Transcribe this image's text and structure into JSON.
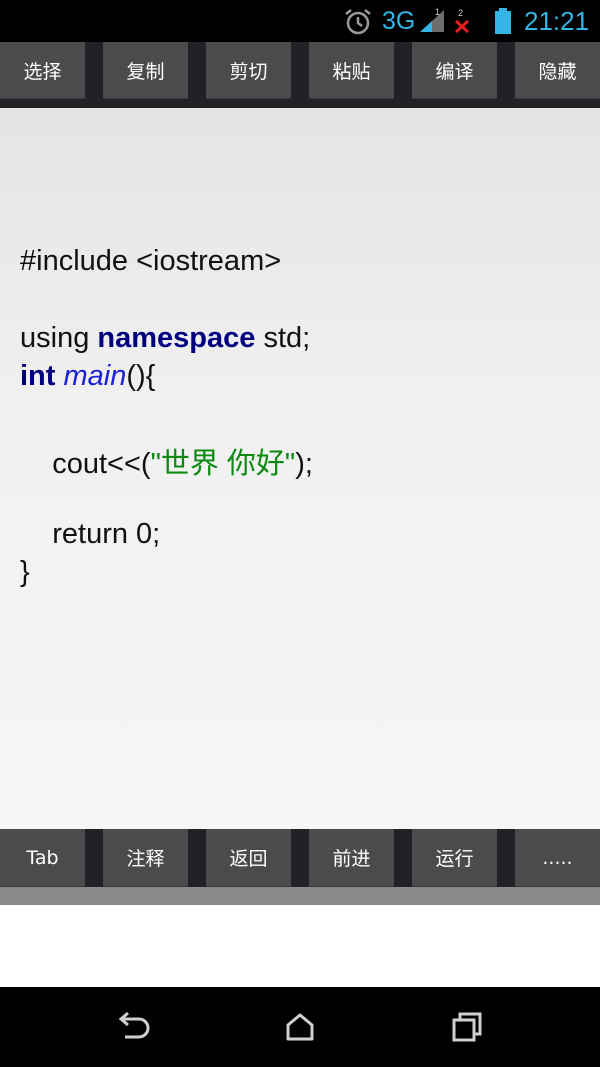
{
  "status_bar": {
    "network": "3G",
    "time": "21:21",
    "sim1_label": "1",
    "sim2_label": "2",
    "icons": [
      "alarm-icon",
      "signal-icon",
      "no-signal-icon",
      "battery-icon"
    ]
  },
  "top_toolbar": {
    "buttons": [
      "选择",
      "复制",
      "剪切",
      "粘贴",
      "编译",
      "隐藏"
    ]
  },
  "editor": {
    "lines": {
      "include": "#include <iostream>",
      "using_prefix": "using ",
      "namespace_kw": "namespace",
      "using_suffix": " std;",
      "int_kw": "int",
      "space": " ",
      "main_fn": "main",
      "main_suffix": "(){",
      "cout_prefix": "    cout<<(",
      "cout_string": "\"世界 你好\"",
      "cout_suffix": ");",
      "return_line": "    return 0;",
      "close_brace": "}"
    },
    "colors": {
      "keyword": "#00007f",
      "function": "#1b21d6",
      "string": "#0b8a10"
    }
  },
  "bottom_toolbar": {
    "buttons": [
      "Tab",
      "注释",
      "返回",
      "前进",
      "运行",
      "....."
    ]
  },
  "nav_bar": {
    "icons": [
      "back-icon",
      "home-icon",
      "recents-icon"
    ]
  }
}
